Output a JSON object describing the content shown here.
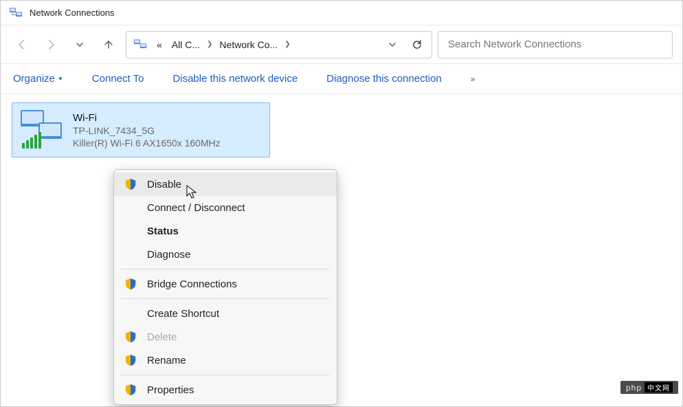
{
  "window": {
    "title": "Network Connections"
  },
  "breadcrumb": {
    "prefix": "«",
    "seg1": "All C...",
    "seg2": "Network Co..."
  },
  "search": {
    "placeholder": "Search Network Connections"
  },
  "toolbar": {
    "organize": "Organize",
    "connect_to": "Connect To",
    "disable_device": "Disable this network device",
    "diagnose": "Diagnose this connection"
  },
  "connection": {
    "name": "Wi-Fi",
    "ssid": "TP-LINK_7434_5G",
    "adapter": "Killer(R) Wi-Fi 6 AX1650x 160MHz"
  },
  "context_menu": {
    "disable": "Disable",
    "connect_disconnect": "Connect / Disconnect",
    "status": "Status",
    "diagnose": "Diagnose",
    "bridge": "Bridge Connections",
    "shortcut": "Create Shortcut",
    "delete": "Delete",
    "rename": "Rename",
    "properties": "Properties"
  },
  "badge": {
    "text": "php"
  }
}
